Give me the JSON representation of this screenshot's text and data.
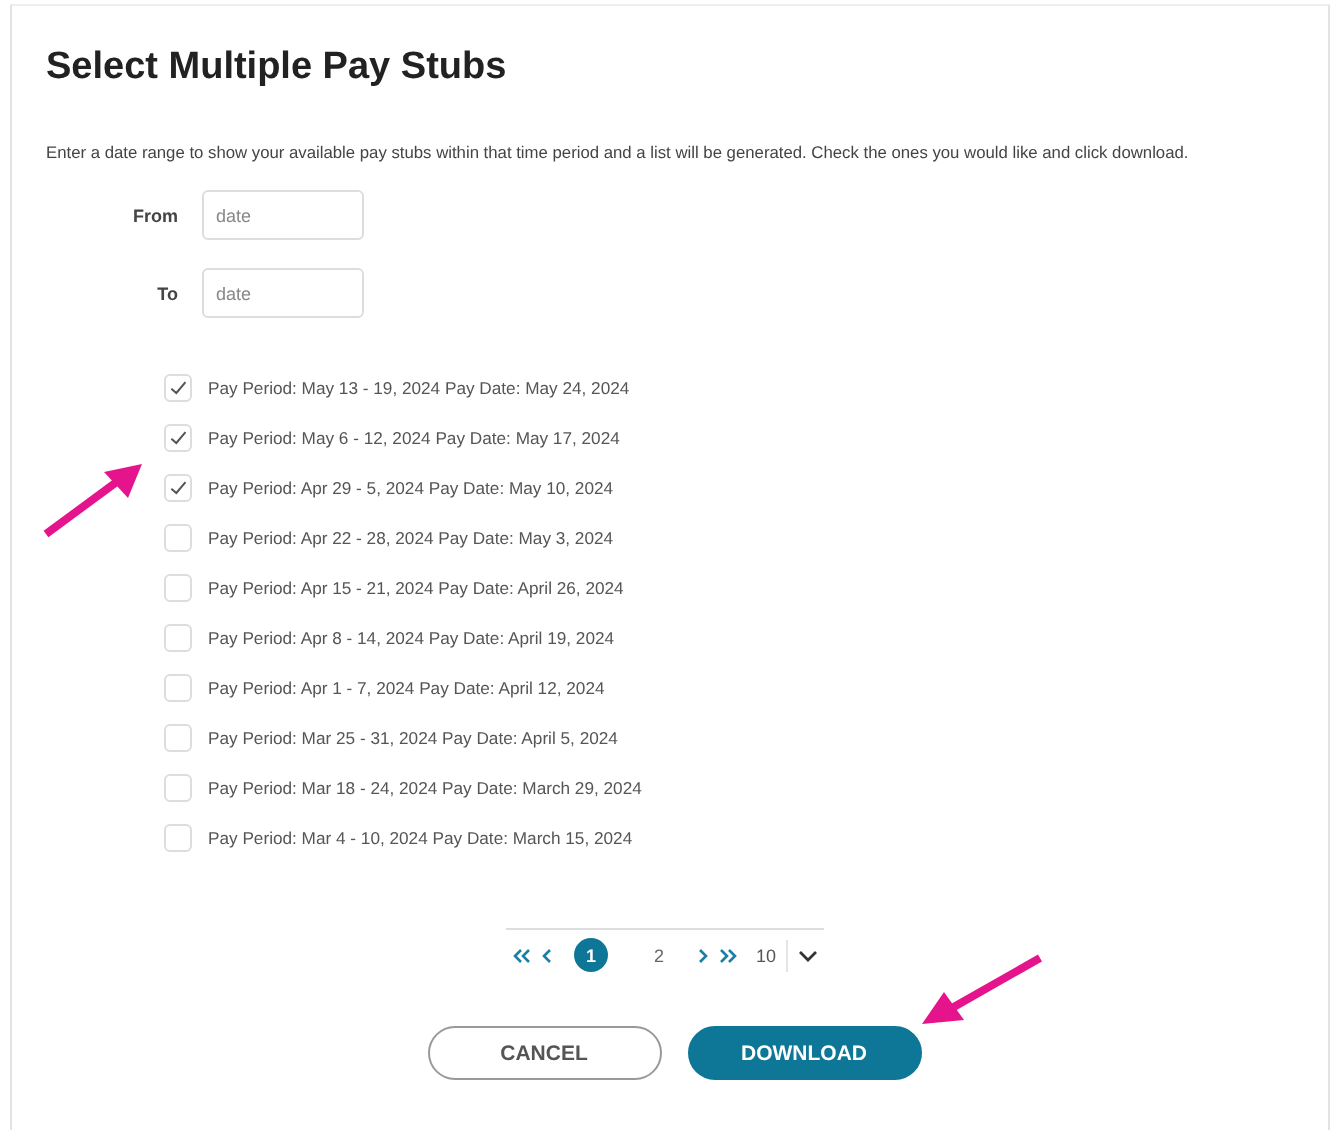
{
  "title": "Select Multiple Pay Stubs",
  "description": "Enter a date range to show your available pay stubs within that time period and a list will be generated. Check the ones you would like and click download.",
  "date_fields": [
    {
      "label": "From",
      "placeholder": "date"
    },
    {
      "label": "To",
      "placeholder": "date"
    }
  ],
  "pay_stubs": [
    {
      "label": "Pay Period: May 13 - 19, 2024 Pay Date: May 24, 2024",
      "checked": true
    },
    {
      "label": "Pay Period: May 6 - 12, 2024 Pay Date: May 17, 2024",
      "checked": true
    },
    {
      "label": "Pay Period: Apr 29 - 5, 2024 Pay Date: May 10, 2024",
      "checked": true
    },
    {
      "label": "Pay Period: Apr 22 - 28, 2024 Pay Date: May 3, 2024",
      "checked": false
    },
    {
      "label": "Pay Period: Apr 15 - 21, 2024 Pay Date: April 26, 2024",
      "checked": false
    },
    {
      "label": "Pay Period: Apr 8 - 14, 2024 Pay Date: April 19, 2024",
      "checked": false
    },
    {
      "label": "Pay Period: Apr 1 - 7, 2024 Pay Date: April 12, 2024",
      "checked": false
    },
    {
      "label": "Pay Period: Mar 25 - 31, 2024 Pay Date: April 5, 2024",
      "checked": false
    },
    {
      "label": "Pay Period: Mar 18 - 24, 2024 Pay Date: March 29, 2024",
      "checked": false
    },
    {
      "label": "Pay Period: Mar 4 - 10, 2024 Pay Date: March 15, 2024",
      "checked": false
    }
  ],
  "pagination": {
    "pages": [
      {
        "label": "1",
        "selected": true
      },
      {
        "label": "2",
        "selected": false
      }
    ],
    "page_size": "10"
  },
  "buttons": [
    {
      "label": "CANCEL",
      "kind": "secondary"
    },
    {
      "label": "DOWNLOAD",
      "kind": "primary"
    }
  ]
}
